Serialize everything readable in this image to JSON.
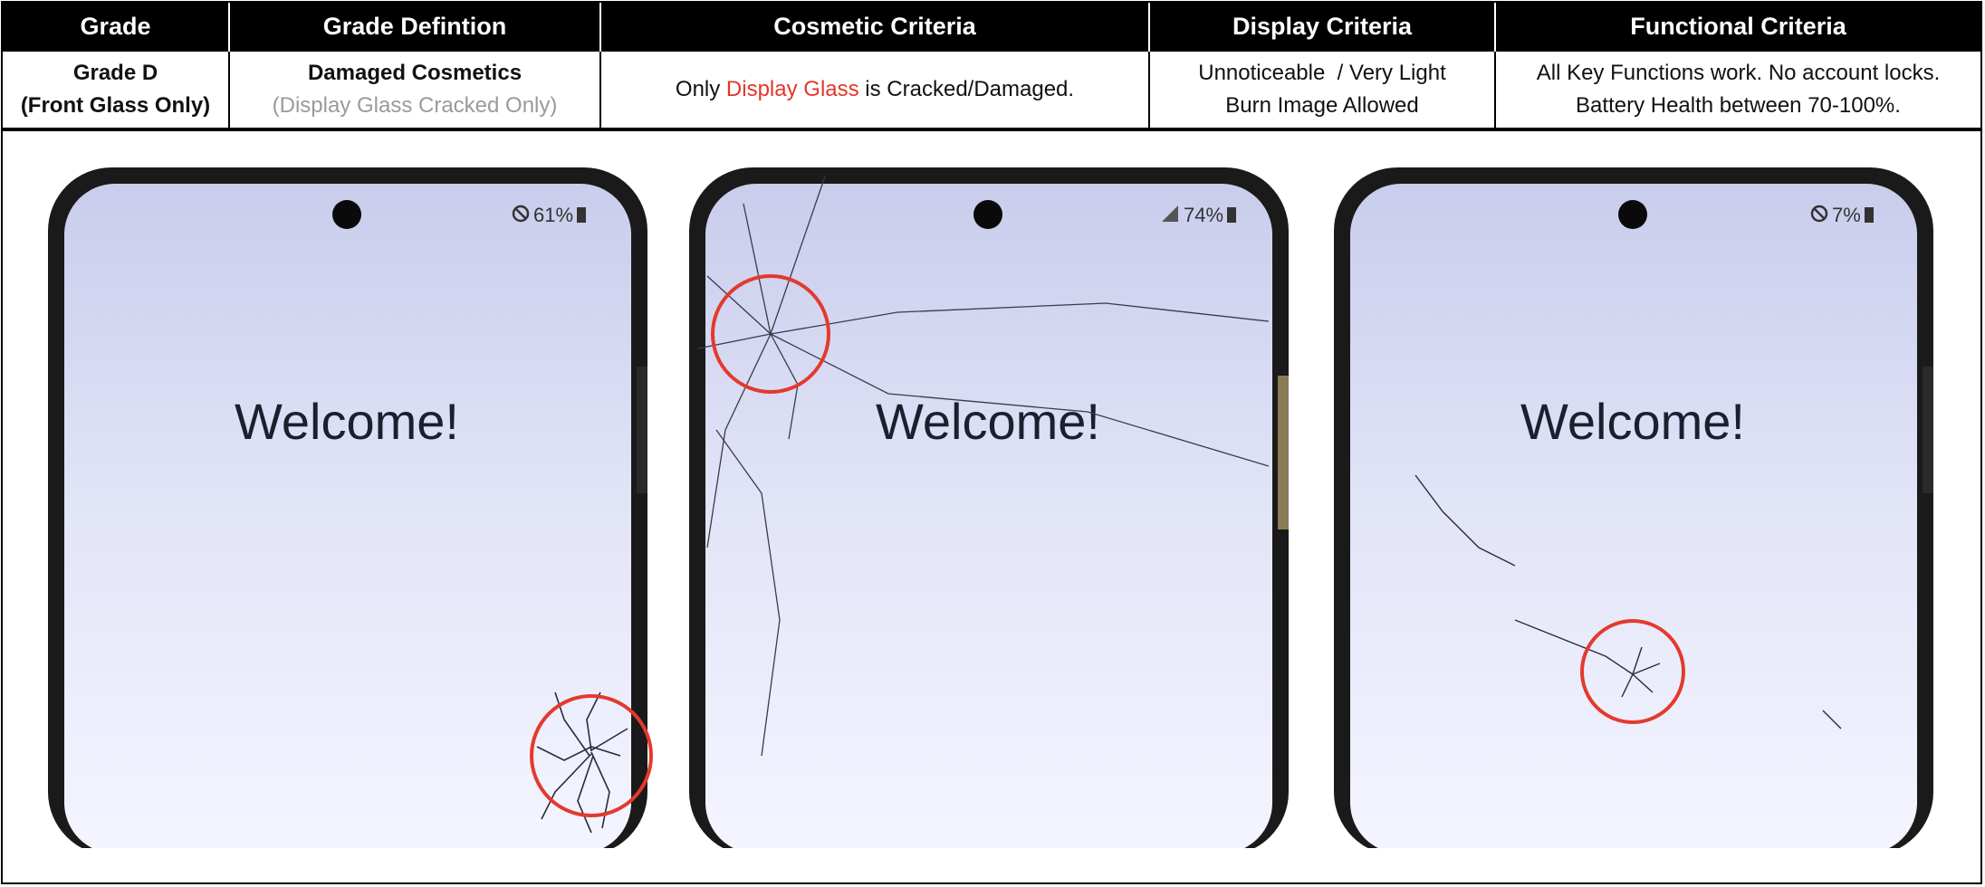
{
  "table": {
    "headers": [
      "Grade",
      "Grade Defintion",
      "Cosmetic Criteria",
      "Display Criteria",
      "Functional Criteria"
    ],
    "row": {
      "grade_line1": "Grade D",
      "grade_line2": "(Front Glass Only)",
      "definition_line1": "Damaged Cosmetics",
      "definition_line2": "(Display Glass Cracked Only)",
      "cosmetic_prefix": "Only ",
      "cosmetic_highlight": "Display Glass",
      "cosmetic_suffix": " is Cracked/Damaged.",
      "display_line1": "Unnoticeable  / Very Light",
      "display_line2": "Burn Image Allowed",
      "functional_line1": "All Key Functions work. No account locks.",
      "functional_line2": "Battery Health between 70-100%."
    }
  },
  "phones": [
    {
      "battery": "61%",
      "status_icon": "no-disturb-icon",
      "welcome": "Welcome!"
    },
    {
      "battery": "74%",
      "status_icon": "signal-icon",
      "welcome": "Welcome!"
    },
    {
      "battery": "7%",
      "status_icon": "no-disturb-icon",
      "welcome": "Welcome!"
    }
  ],
  "colors": {
    "highlight_red": "#e2362b",
    "circle_red": "#e23a2d",
    "screen_top": "#ccd0ee",
    "screen_bottom": "#f2f3ff"
  }
}
